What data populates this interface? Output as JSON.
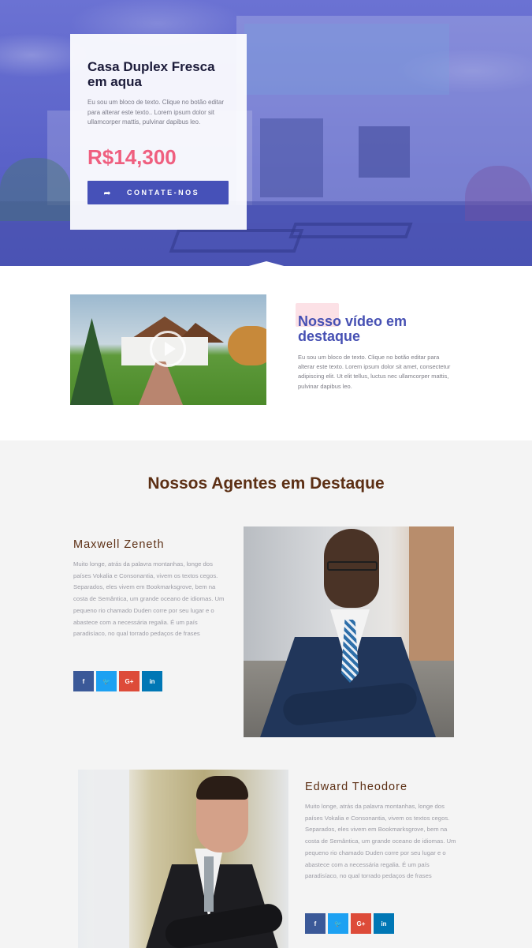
{
  "hero": {
    "title": "Casa Duplex Fresca em aqua",
    "text": "Eu sou um bloco de texto. Clique no botão editar para alterar este texto.. Lorem ipsum dolor sit ullamcorper mattis, pulvinar dapibus leo.",
    "price": "R$14,300",
    "cta_label": "CONTATE-NOS",
    "cta_icon": "share-arrow-icon",
    "price_color": "#ef5f7f",
    "accent_color": "#4651b8"
  },
  "video": {
    "title": "Nosso vídeo em destaque",
    "text": "Eu sou um bloco de texto. Clique no botão editar para alterar este texto. Lorem ipsum dolor sit amet, consectetur adipiscing elit. Ut elit tellus, luctus nec ullamcorper mattis, pulvinar dapibus leo.",
    "play_icon": "play-icon"
  },
  "agents": {
    "title": "Nossos Agentes em Destaque",
    "items": [
      {
        "name": "Maxwell Zeneth",
        "bio": "Muito longe, atrás da palavra montanhas, longe dos países Vokalia e Consonantia, vivem os textos cegos. Separados, eles vivem em Bookmarksgrove, bem na costa de Semântica, um grande oceano de idiomas. Um pequeno rio chamado Duden corre por seu lugar e o abastece com a necessária regalia. É um país paradisíaco, no qual torrado pedaços de frases",
        "socials": [
          {
            "icon": "facebook-icon",
            "glyph": "f"
          },
          {
            "icon": "twitter-icon",
            "glyph": "🐦"
          },
          {
            "icon": "google-plus-icon",
            "glyph": "G+"
          },
          {
            "icon": "linkedin-icon",
            "glyph": "in"
          }
        ]
      },
      {
        "name": "Edward Theodore",
        "bio": "Muito longe, atrás da palavra montanhas, longe dos países Vokalia e Consonantia, vivem os textos cegos. Separados, eles vivem em Bookmarksgrove, bem na costa de Semântica, um grande oceano de idiomas. Um pequeno rio chamado Duden corre por seu lugar e o abastece com a necessária regalia. É um país paradisíaco, no qual torrado pedaços de frases",
        "socials": [
          {
            "icon": "facebook-icon",
            "glyph": "f"
          },
          {
            "icon": "twitter-icon",
            "glyph": "🐦"
          },
          {
            "icon": "google-plus-icon",
            "glyph": "G+"
          },
          {
            "icon": "linkedin-icon",
            "glyph": "in"
          }
        ]
      }
    ]
  }
}
